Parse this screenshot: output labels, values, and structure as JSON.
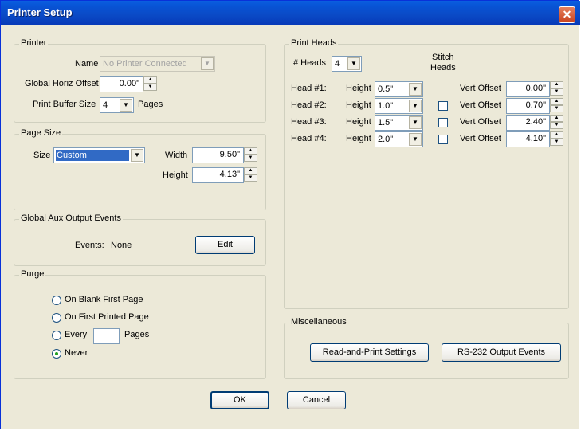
{
  "window": {
    "title": "Printer Setup",
    "close_glyph": "✕"
  },
  "printer": {
    "group_label": "Printer",
    "name_label": "Name",
    "name_value": "No Printer Connected",
    "offset_label": "Global Horiz Offset",
    "offset_value": "0.00\"",
    "buffer_label": "Print Buffer Size",
    "buffer_value": "4",
    "pages_label": "Pages"
  },
  "page_size": {
    "group_label": "Page Size",
    "size_label": "Size",
    "size_value": "Custom",
    "width_label": "Width",
    "width_value": "9.50\"",
    "height_label": "Height",
    "height_value": "4.13\""
  },
  "aux": {
    "group_label": "Global Aux Output Events",
    "events_label": "Events:",
    "events_value": "None",
    "edit_label": "Edit"
  },
  "purge": {
    "group_label": "Purge",
    "options": [
      {
        "label": "On Blank First Page",
        "checked": false
      },
      {
        "label": "On First Printed Page",
        "checked": false
      },
      {
        "label": "Every",
        "checked": false
      },
      {
        "label": "Never",
        "checked": true
      }
    ],
    "pages_label": "Pages",
    "every_value": ""
  },
  "print_heads": {
    "group_label": "Print Heads",
    "count_label": "# Heads",
    "count_value": "4",
    "stitch_label_line1": "Stitch",
    "stitch_label_line2": "Heads",
    "height_label": "Height",
    "vert_offset_label": "Vert Offset",
    "heads": [
      {
        "label": "Head #1:",
        "height": "0.5\"",
        "vert_offset": "0.00\"",
        "has_stitch": false,
        "stitch_checked": false
      },
      {
        "label": "Head #2:",
        "height": "1.0\"",
        "vert_offset": "0.70\"",
        "has_stitch": true,
        "stitch_checked": false
      },
      {
        "label": "Head #3:",
        "height": "1.5\"",
        "vert_offset": "2.40\"",
        "has_stitch": true,
        "stitch_checked": false
      },
      {
        "label": "Head #4:",
        "height": "2.0\"",
        "vert_offset": "4.10\"",
        "has_stitch": true,
        "stitch_checked": false
      }
    ]
  },
  "misc": {
    "group_label": "Miscellaneous",
    "read_print_label": "Read-and-Print Settings",
    "rs232_label": "RS-232 Output Events"
  },
  "footer": {
    "ok_label": "OK",
    "cancel_label": "Cancel"
  },
  "icons": {
    "spin_up": "▲",
    "spin_down": "▼",
    "dropdown": "▼"
  },
  "colors": {
    "titlebar": "#0854d6",
    "dialog_bg": "#ece9d8",
    "selection": "#316ac5",
    "close": "#c9431f",
    "radio_dot": "#21a121"
  }
}
